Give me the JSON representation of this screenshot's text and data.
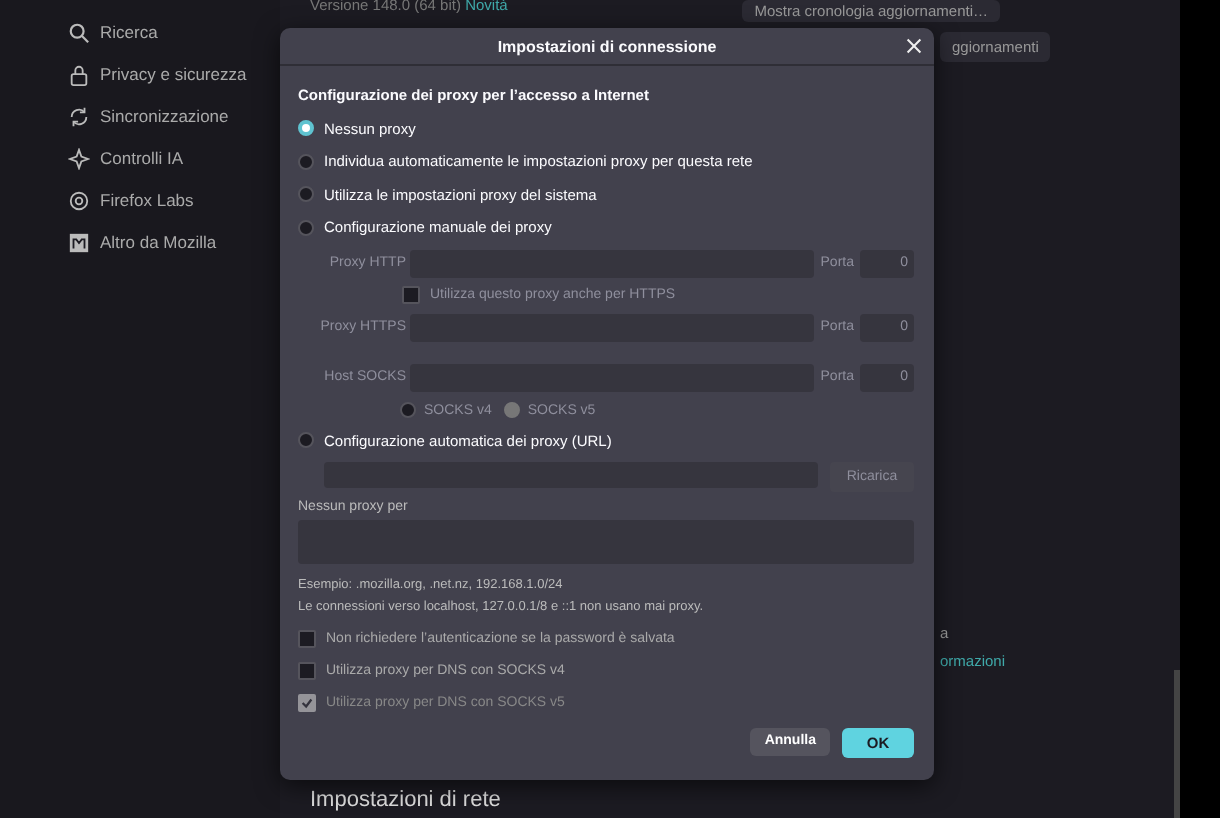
{
  "sidebar": {
    "items": [
      {
        "label": "Ricerca"
      },
      {
        "label": "Privacy e sicurezza"
      },
      {
        "label": "Sincronizzazione"
      },
      {
        "label": "Controlli IA"
      },
      {
        "label": "Firefox Labs"
      },
      {
        "label": "Altro da Mozilla"
      }
    ]
  },
  "page": {
    "version": "Versione 148.0 (64 bit)",
    "whats_new_link": "Novità",
    "history_button": "Mostra cronologia aggiornamenti…",
    "updates_button_partial": "ggiornamenti",
    "fragment_1": "a",
    "fragment_link": "ormazioni",
    "section_heading": "Impostazioni di rete"
  },
  "dialog": {
    "title": "Impostazioni di connessione",
    "heading": "Configurazione dei proxy per l’accesso a Internet",
    "proxy_modes": [
      {
        "kind": "none",
        "label": "Nessun proxy",
        "selected": true
      },
      {
        "kind": "auto_detect",
        "label": "Individua automaticamente le impostazioni proxy per questa rete",
        "selected": false
      },
      {
        "kind": "system",
        "label": "Utilizza le impostazioni proxy del sistema",
        "selected": false
      },
      {
        "kind": "manual",
        "label": "Configurazione manuale dei proxy",
        "selected": false
      },
      {
        "kind": "pac",
        "label": "Configurazione automatica dei proxy (URL)",
        "selected": false
      }
    ],
    "manual": {
      "disabled": true,
      "http": {
        "label": "Proxy HTTP",
        "port_label": "Porta",
        "port_value": "0"
      },
      "also_https": {
        "label": "Utilizza questo proxy anche per HTTPS",
        "checked": false
      },
      "https": {
        "label": "Proxy HTTPS",
        "port_label": "Porta",
        "port_value": "0"
      },
      "socks": {
        "label": "Host SOCKS",
        "port_label": "Porta",
        "port_value": "0"
      },
      "socks_versions": [
        {
          "label": "SOCKS v4",
          "selected": false
        },
        {
          "label": "SOCKS v5",
          "selected": true
        }
      ]
    },
    "pac": {
      "reload_button": "Ricarica",
      "disabled": true
    },
    "no_proxy": {
      "label": "Nessun proxy per",
      "hints": [
        "Esempio: .mozilla.org, .net.nz, 192.168.1.0/24",
        "Le connessioni verso localhost, 127.0.0.1/8 e ::1 non usano mai proxy."
      ]
    },
    "options": [
      {
        "label": "Non richiedere l’autenticazione se la password è salvata",
        "checked": false,
        "disabled": false
      },
      {
        "label": "Utilizza proxy per DNS con SOCKS v4",
        "checked": false,
        "disabled": false
      },
      {
        "label": "Utilizza proxy per DNS con SOCKS v5",
        "checked": true,
        "disabled": true
      }
    ],
    "buttons": {
      "cancel": "Annulla",
      "ok": "OK"
    }
  }
}
